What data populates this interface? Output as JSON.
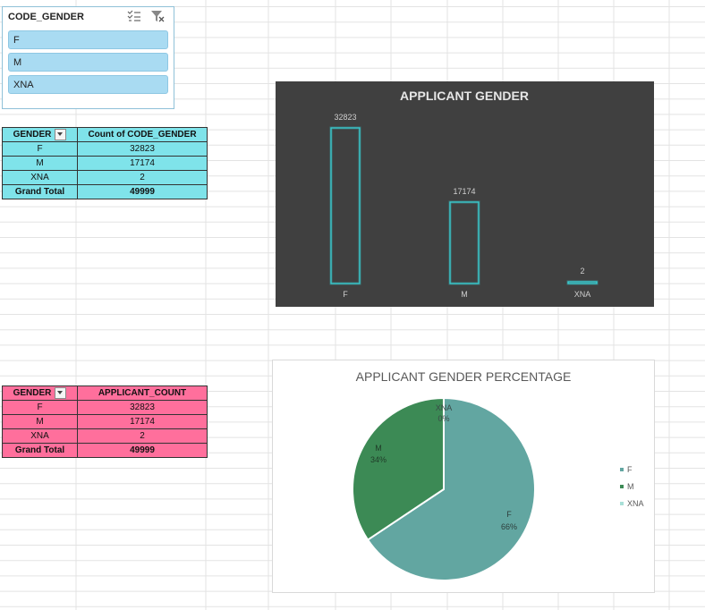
{
  "slicer": {
    "title": "CODE_GENDER",
    "icons": [
      "multi-select-icon",
      "clear-filter-icon"
    ],
    "items": [
      "F",
      "M",
      "XNA"
    ]
  },
  "table1": {
    "headers": [
      "GENDER",
      "Count of CODE_GENDER"
    ],
    "rows": [
      [
        "F",
        "32823"
      ],
      [
        "M",
        "17174"
      ],
      [
        "XNA",
        "2"
      ]
    ],
    "total": [
      "Grand Total",
      "49999"
    ]
  },
  "table2": {
    "headers": [
      "GENDER",
      "APPLICANT_COUNT"
    ],
    "rows": [
      [
        "F",
        "32823"
      ],
      [
        "M",
        "17174"
      ],
      [
        "XNA",
        "2"
      ]
    ],
    "total": [
      "Grand Total",
      "49999"
    ]
  },
  "colors": {
    "table1_fill": "#7fe3ea",
    "table2_fill": "#ff6f9c",
    "bar_chart_bg": "#404040",
    "bar_outline": "#3ad1d6",
    "pie_F": "#62a6a1",
    "pie_M": "#3c8a55",
    "pie_XNA": "#a9e0d8"
  },
  "chart_data": [
    {
      "type": "bar",
      "title": "APPLICANT GENDER",
      "categories": [
        "F",
        "M",
        "XNA"
      ],
      "values": [
        32823,
        17174,
        2
      ],
      "data_labels": [
        "32823",
        "17174",
        "2"
      ],
      "ylim": [
        0,
        32823
      ],
      "grid": false,
      "legend": "none"
    },
    {
      "type": "pie",
      "title": "APPLICANT GENDER PERCENTAGE",
      "categories": [
        "F",
        "M",
        "XNA"
      ],
      "values": [
        32823,
        17174,
        2
      ],
      "percent_labels": [
        "66%",
        "34%",
        "0%"
      ],
      "legend": "right"
    }
  ]
}
